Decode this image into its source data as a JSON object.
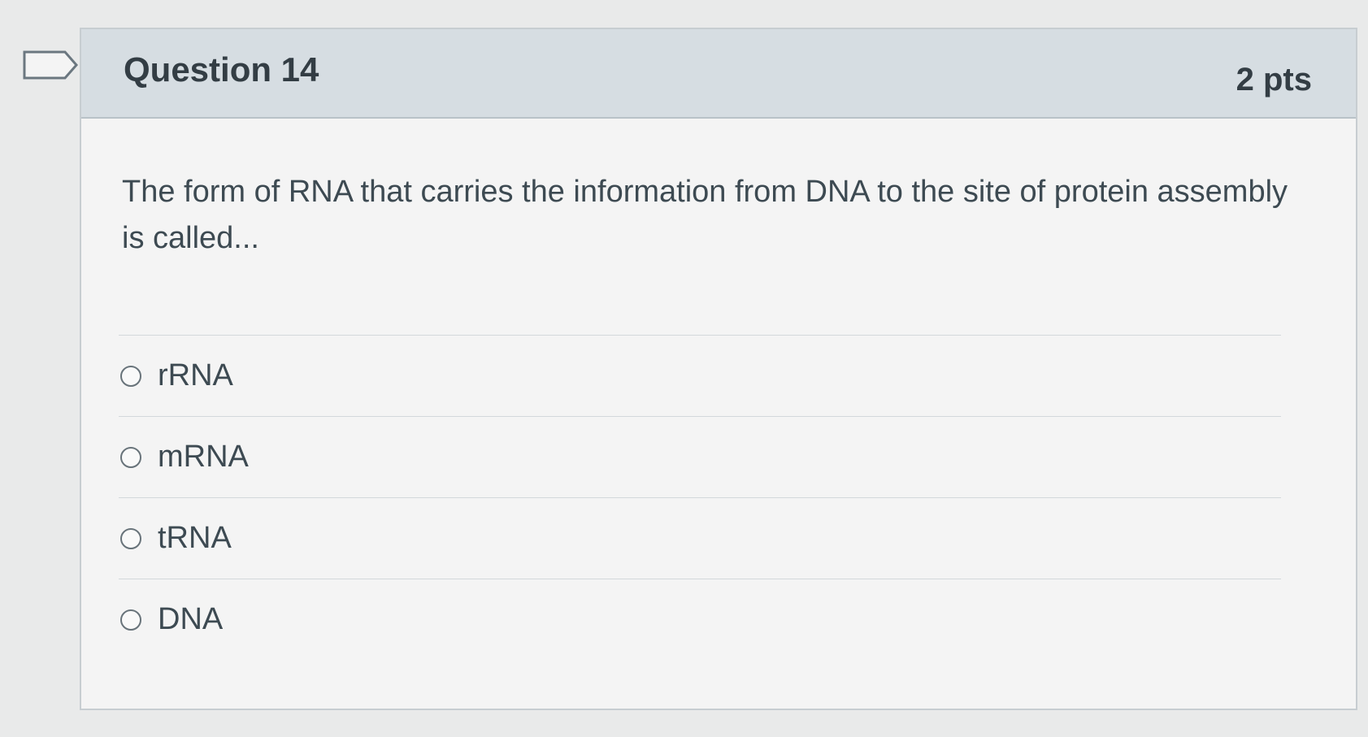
{
  "question": {
    "title": "Question 14",
    "points": "2 pts",
    "text": "The form of RNA that carries the information from DNA to the site of protein assembly is called...",
    "flag_icon": "bookmark-flag-icon"
  },
  "answers": [
    {
      "label": "rRNA",
      "selected": false
    },
    {
      "label": "mRNA",
      "selected": false
    },
    {
      "label": "tRNA",
      "selected": false
    },
    {
      "label": "DNA",
      "selected": false
    }
  ],
  "colors": {
    "header_background": "#d6dde2",
    "card_background": "#f4f4f4",
    "text": "#3d4a52"
  }
}
